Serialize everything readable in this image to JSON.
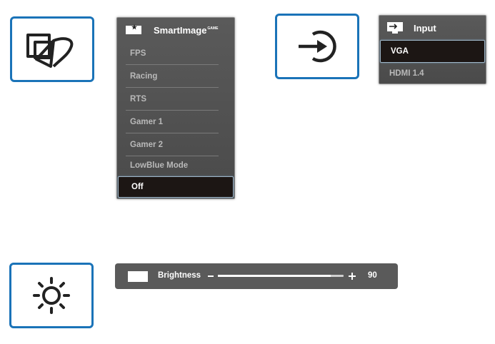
{
  "smartimage": {
    "title": "SmartImage",
    "title_sup": "GAME",
    "items": [
      "FPS",
      "Racing",
      "RTS",
      "Gamer 1",
      "Gamer 2",
      "LowBlue Mode"
    ],
    "selected": "Off"
  },
  "input": {
    "title": "Input",
    "selected": "VGA",
    "items": [
      "HDMI 1.4"
    ]
  },
  "brightness": {
    "label": "Brightness",
    "value": "90",
    "level": 0.9
  },
  "colors": {
    "icon_border": "#1a73b8",
    "menu_bg": "#555555",
    "selected_bg": "#1c1614"
  }
}
